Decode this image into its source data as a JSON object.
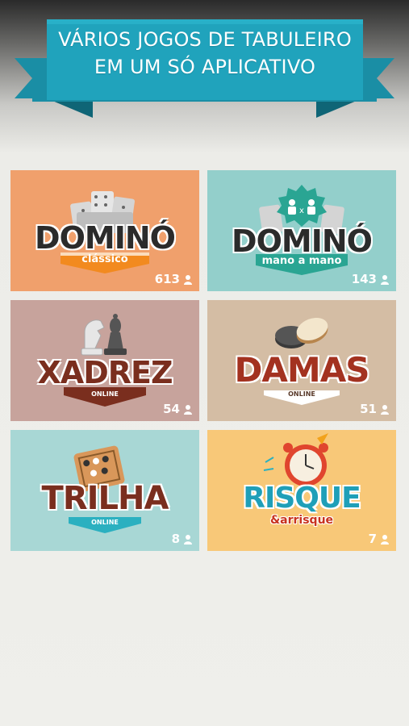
{
  "banner": {
    "line1": "VÁRIOS JOGOS DE TABULEIRO",
    "line2": "EM UM SÓ APLICATIVO"
  },
  "games": [
    {
      "title": "DOMINÓ",
      "subtitle": "clássico",
      "players": "613",
      "bg": "#f0a06c",
      "icon": "domino-tiles-icon"
    },
    {
      "title": "DOMINÓ",
      "subtitle": "mano a mano",
      "players": "143",
      "bg": "#93cfcb",
      "icon": "domino-versus-icon"
    },
    {
      "title": "XADREZ",
      "subtitle": "ONLINE",
      "players": "54",
      "bg": "#c7a39c",
      "icon": "chess-pieces-icon"
    },
    {
      "title": "DAMAS",
      "subtitle": "ONLINE",
      "players": "51",
      "bg": "#d4bda4",
      "icon": "checkers-pieces-icon"
    },
    {
      "title": "TRILHA",
      "subtitle": "ONLINE",
      "players": "8",
      "bg": "#a8d7d5",
      "icon": "board-icon"
    },
    {
      "title": "RISQUE",
      "subtitle": "arrisque",
      "subtitle_prefix": "&",
      "players": "7",
      "bg": "#f8c878",
      "icon": "alarm-clock-icon"
    }
  ],
  "colors": {
    "ribbon": "#1f9fb8",
    "ribbon_dark": "#157a8e",
    "brown_text": "#7a2e1e",
    "dark_text": "#2b2b2b"
  },
  "player_icon": "person-icon"
}
